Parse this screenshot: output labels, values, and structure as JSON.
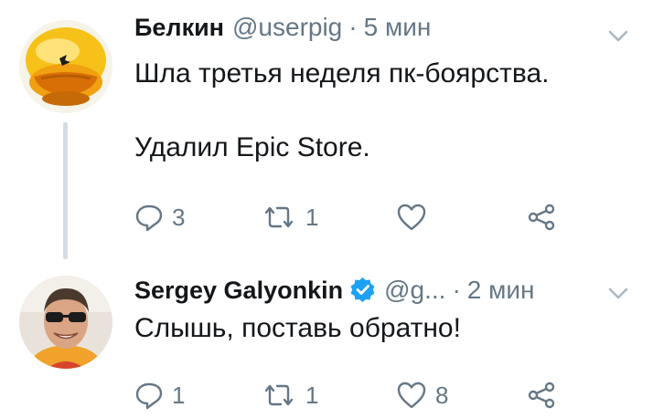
{
  "tweets": [
    {
      "author": "Белкин",
      "handle": "@userpig",
      "separator": "·",
      "time": "5 мин",
      "text_lines": [
        "Шла третья неделя пк-боярства.",
        "Удалил Epic Store."
      ],
      "replies": "3",
      "retweets": "1",
      "likes": "",
      "verified": false
    },
    {
      "author": "Sergey Galyonkin",
      "handle": "@g...",
      "separator": "·",
      "time": "2 мин",
      "text_lines": [
        "Слышь, поставь обратно!"
      ],
      "replies": "1",
      "retweets": "1",
      "likes": "8",
      "verified": true
    }
  ],
  "colors": {
    "text": "#14171a",
    "secondary": "#657786",
    "verified": "#1da1f2",
    "thread_line": "#d5dce1"
  },
  "icons": [
    "reply-icon",
    "retweet-icon",
    "like-icon",
    "share-icon",
    "chevron-down-icon",
    "verified-badge-icon"
  ]
}
